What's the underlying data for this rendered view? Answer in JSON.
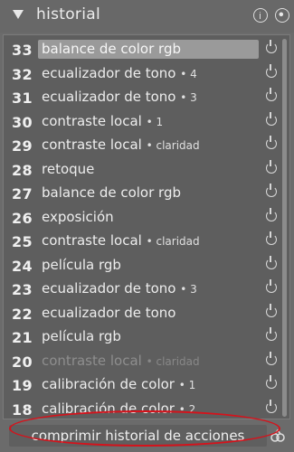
{
  "header": {
    "title": "historial",
    "icons": [
      "collapse-triangle-icon",
      "info-icon",
      "presets-icon"
    ]
  },
  "history": [
    {
      "num": "33",
      "label": "balance de color rgb",
      "meta": "",
      "selected": true,
      "enabled": true
    },
    {
      "num": "32",
      "label": "ecualizador de tono",
      "meta": "• 4",
      "enabled": true
    },
    {
      "num": "31",
      "label": "ecualizador de tono",
      "meta": "• 3",
      "enabled": true
    },
    {
      "num": "30",
      "label": "contraste local",
      "meta": "• 1",
      "enabled": true
    },
    {
      "num": "29",
      "label": "contraste local",
      "meta": "• claridad",
      "enabled": true
    },
    {
      "num": "28",
      "label": "retoque",
      "meta": "",
      "enabled": true
    },
    {
      "num": "27",
      "label": "balance de color rgb",
      "meta": "",
      "enabled": true
    },
    {
      "num": "26",
      "label": "exposición",
      "meta": "",
      "enabled": true
    },
    {
      "num": "25",
      "label": "contraste local",
      "meta": "• claridad",
      "enabled": true
    },
    {
      "num": "24",
      "label": "película rgb",
      "meta": "",
      "enabled": true
    },
    {
      "num": "23",
      "label": "ecualizador de tono",
      "meta": "• 3",
      "enabled": true
    },
    {
      "num": "22",
      "label": "ecualizador de tono",
      "meta": "",
      "enabled": true
    },
    {
      "num": "21",
      "label": "película rgb",
      "meta": "",
      "enabled": true
    },
    {
      "num": "20",
      "label": "contraste local",
      "meta": "• claridad",
      "enabled": false
    },
    {
      "num": "19",
      "label": "calibración de color",
      "meta": "• 1",
      "enabled": true
    },
    {
      "num": "18",
      "label": "calibración de color",
      "meta": "• 2",
      "enabled": true
    }
  ],
  "footer": {
    "compress_label": "comprimir historial de acciones"
  },
  "colors": {
    "background": "#6b6b6b",
    "panel": "#5e5e5e",
    "selected": "#9a9a9a",
    "highlight_annotation": "#d6121b"
  }
}
